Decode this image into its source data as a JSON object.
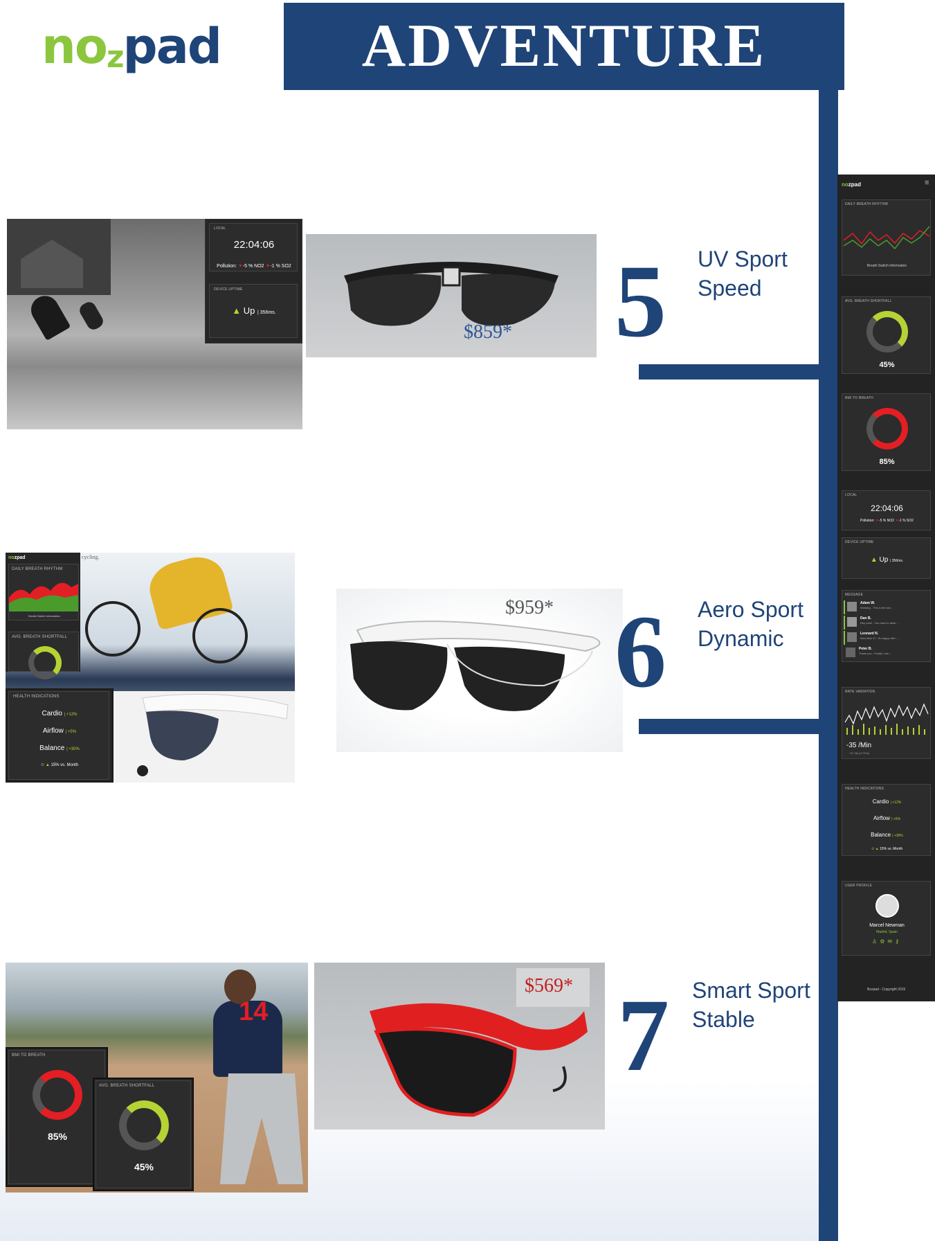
{
  "brand": {
    "logo_text_green": "no",
    "logo_text_z": "z",
    "logo_text_blue": "pad",
    "colors": {
      "green": "#8cc63f",
      "navy": "#1f4478",
      "dark": "#2b2b2b",
      "red": "#e31e24",
      "lime": "#b5d334"
    }
  },
  "header": {
    "title": "ADVENTURE"
  },
  "products": [
    {
      "number": "5",
      "name": "UV Sport",
      "variant": "Speed",
      "price": "$859*"
    },
    {
      "number": "6",
      "name": "Aero Sport",
      "variant": "Dynamic",
      "price": "$959*"
    },
    {
      "number": "7",
      "name": "Smart Sport",
      "variant": "Stable",
      "price": "$569*"
    }
  ],
  "widgets": {
    "local": {
      "label": "LOCAL",
      "time": "22:04:06",
      "pollution_label": "Pollution:",
      "no2": "-5 % NO2",
      "so2": "-1 % SO2"
    },
    "uptime": {
      "label": "DEVICE UPTIME",
      "status": "Up",
      "ms": "| 356ms."
    },
    "breath_rhythm": {
      "label": "DAILY BREATH RHYTHM",
      "caption": "Breath Switch Information"
    },
    "avg_shortfall": {
      "label": "AVG. BREATH SHORTFALL",
      "percent": "45%",
      "value": 0.45
    },
    "bmi": {
      "label": "BMI TO BREATH",
      "percent": "85%",
      "value": 0.85
    },
    "health": {
      "label": "HEALTH INDICATIONS",
      "cardio": "Cardio",
      "cardio_v": "| +12%",
      "airflow": "Airflow",
      "airflow_v": "| +5%",
      "balance": "Balance",
      "balance_v": "| +30%",
      "trend": "15% vs. Month"
    },
    "message": {
      "label": "MESSAGE",
      "items": [
        {
          "name": "Adam W.",
          "text": "Working - This is the last..."
        },
        {
          "name": "Dan B.",
          "text": "Hey man! - You have to taste ..."
        },
        {
          "name": "Leonard N.",
          "text": "New Man :D - So happy with ..."
        },
        {
          "name": "Peter B.",
          "text": "Thank you - Finally I can ..."
        }
      ]
    },
    "rate": {
      "label": "RATE VARIATION",
      "value": "-35 /Min",
      "sub": "+17.18 (-3.71%)"
    },
    "profile": {
      "label": "USER PROFILE",
      "name": "Marcel Newman",
      "location": "Madrid, Spain"
    },
    "footer": "Nozpad - Copyright 2015",
    "cycling_caption": "cycling."
  }
}
